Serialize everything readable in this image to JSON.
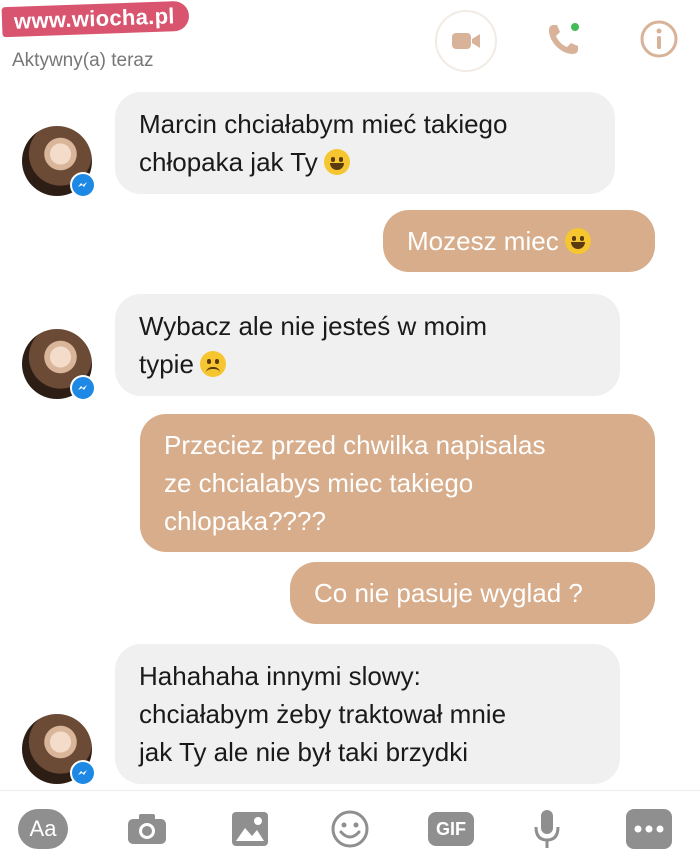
{
  "header": {
    "watermark": "www.wiocha.pl",
    "status": "Aktywny(a) teraz",
    "icons": [
      "video-camera-icon",
      "phone-icon",
      "info-icon"
    ]
  },
  "messages": [
    {
      "side": "incoming",
      "lines": [
        "Marcin chciałabym mieć takiego",
        "chłopaka jak Ty"
      ],
      "emoji": "tears-of-joy-emoji"
    },
    {
      "side": "outgoing",
      "lines": [
        "Mozesz miec"
      ],
      "emoji": "smiling-emoji"
    },
    {
      "side": "incoming",
      "lines": [
        "Wybacz ale nie jesteś w moim",
        "typie"
      ],
      "emoji": "disappointed-emoji"
    },
    {
      "side": "outgoing",
      "lines": [
        "Przeciez przed chwilka napisalas",
        "ze chcialabys miec takiego",
        "chlopaka????"
      ]
    },
    {
      "side": "outgoing",
      "lines": [
        "Co nie pasuje wyglad ?"
      ]
    },
    {
      "side": "incoming",
      "lines": [
        "Hahahaha innymi slowy:",
        "chciałabym żeby traktował mnie",
        "jak Ty ale nie był taki brzydki"
      ]
    }
  ],
  "toolbar": {
    "aa_label": "Aa",
    "gif_label": "GIF",
    "icons": [
      "text-format-icon",
      "camera-icon",
      "image-icon",
      "emoji-icon",
      "gif-icon",
      "microphone-icon",
      "more-icon"
    ]
  },
  "colors": {
    "incoming_bubble": "#f1f0f0",
    "outgoing_bubble": "#d7ad8b",
    "watermark": "#d9546e",
    "online_dot": "#44bb55",
    "messenger_badge": "#1e88e5"
  }
}
